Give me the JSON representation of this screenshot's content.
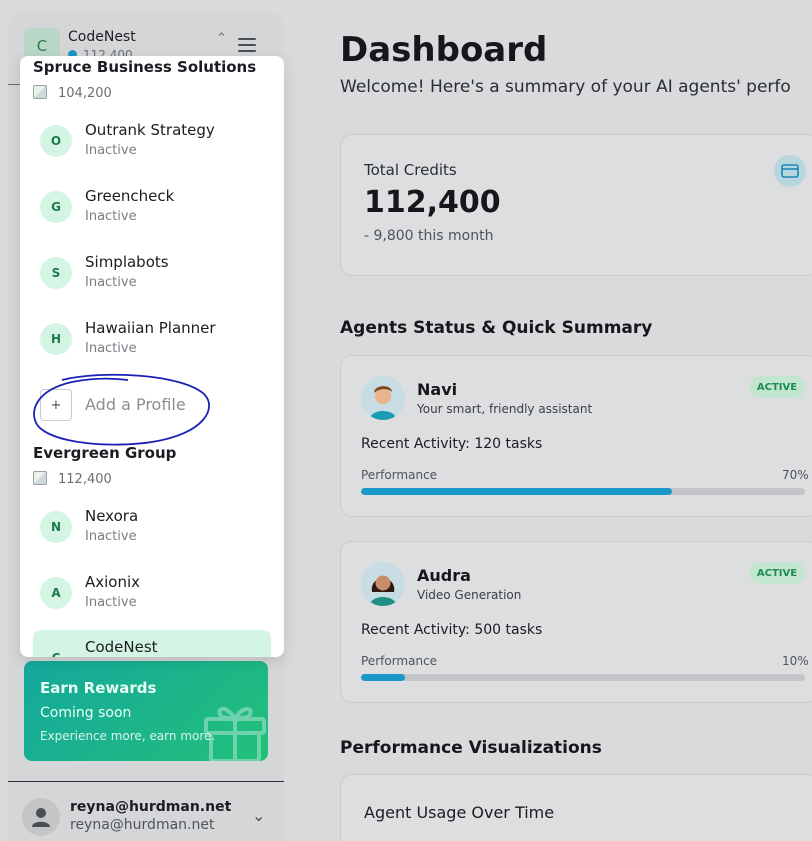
{
  "sidebar": {
    "workspace": {
      "initial": "C",
      "name": "CodeNest",
      "credits": "112,400"
    },
    "rewards": {
      "title": "Earn Rewards",
      "subtitle": "Coming soon",
      "description": "Experience more, earn more."
    },
    "user": {
      "email": "reyna@hurdman.net",
      "sub": "reyna@hurdman.net"
    }
  },
  "dropdown": {
    "groups": [
      {
        "title": "Spruce Business Solutions",
        "credits": "104,200",
        "profiles": [
          {
            "initial": "O",
            "name": "Outrank Strategy",
            "status": "Inactive"
          },
          {
            "initial": "G",
            "name": "Greencheck",
            "status": "Inactive"
          },
          {
            "initial": "S",
            "name": "Simplabots",
            "status": "Inactive"
          },
          {
            "initial": "H",
            "name": "Hawaiian Planner",
            "status": "Inactive"
          }
        ],
        "add_label": "Add a Profile"
      },
      {
        "title": "Evergreen Group",
        "credits": "112,400",
        "profiles": [
          {
            "initial": "N",
            "name": "Nexora",
            "status": "Inactive"
          },
          {
            "initial": "A",
            "name": "Axionix",
            "status": "Inactive"
          },
          {
            "initial": "C",
            "name": "CodeNest",
            "status": ""
          }
        ]
      }
    ],
    "add_symbol": "+"
  },
  "main": {
    "title": "Dashboard",
    "subtitle": "Welcome! Here's a summary of your AI agents' perfo",
    "credits_card": {
      "label": "Total Credits",
      "value": "112,400",
      "month": "- 9,800 this month"
    },
    "agents_section_title": "Agents Status & Quick Summary",
    "agents": [
      {
        "name": "Navi",
        "description": "Your smart, friendly assistant",
        "badge": "ACTIVE",
        "activity": "Recent Activity: 120 tasks",
        "performance_label": "Performance",
        "performance_text": "70%",
        "performance": 0.7
      },
      {
        "name": "Audra",
        "description": "Video Generation",
        "badge": "ACTIVE",
        "activity": "Recent Activity: 500 tasks",
        "performance_label": "Performance",
        "performance_text": "10%",
        "performance": 0.1
      }
    ],
    "viz_section_title": "Performance Visualizations",
    "usage_card_title": "Agent Usage Over Time"
  },
  "colors": {
    "accent": "#1a98c9",
    "active_badge_bg": "#c3e6d1",
    "active_badge_text": "#1f8a4e",
    "profile_avatar_bg": "#d4f5e4",
    "annotation": "#1a1fb8"
  }
}
